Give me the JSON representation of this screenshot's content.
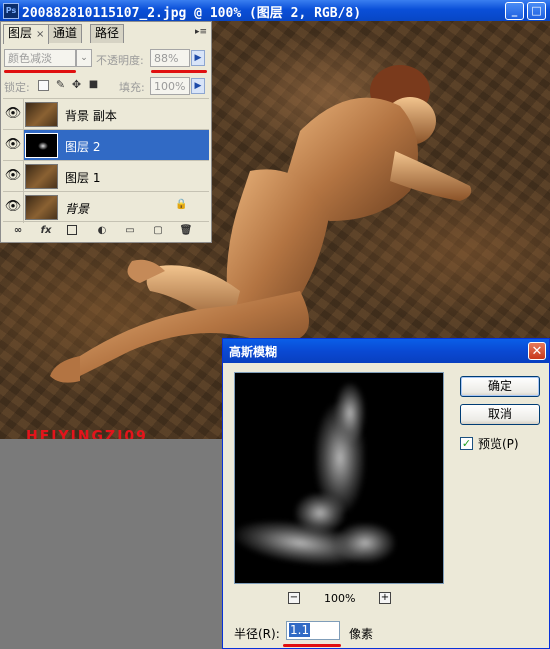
{
  "window": {
    "title": "200882810115107_2.jpg @ 100% (图层 2, RGB/8)",
    "app_icon": "Ps",
    "minimize": "_",
    "maximize": "□",
    "close": "✕"
  },
  "watermark": "HEIYINGZI09",
  "layers_panel": {
    "tabs": [
      {
        "label": "图层",
        "close": "×",
        "active": true
      },
      {
        "label": "通道",
        "active": false
      },
      {
        "label": "路径",
        "active": false
      }
    ],
    "blend_mode": "颜色减淡",
    "opacity_label": "不透明度:",
    "opacity_value": "88%",
    "lock_label": "锁定:",
    "fill_label": "填充:",
    "fill_value": "100%",
    "layers": [
      {
        "name": "背景 副本",
        "visible": true,
        "selected": false,
        "thumb": "photo",
        "locked": false,
        "italic": false
      },
      {
        "name": "图层 2",
        "visible": true,
        "selected": true,
        "thumb": "dark",
        "locked": false,
        "italic": false
      },
      {
        "name": "图层 1",
        "visible": true,
        "selected": false,
        "thumb": "photo",
        "locked": false,
        "italic": false
      },
      {
        "name": "背景",
        "visible": true,
        "selected": false,
        "thumb": "photo",
        "locked": true,
        "italic": true
      }
    ],
    "footer_icons": [
      "link-icon",
      "fx-icon",
      "mask-icon",
      "adjustment-icon",
      "folder-icon",
      "new-layer-icon",
      "trash-icon"
    ],
    "footer_fx": "fx"
  },
  "blur_dialog": {
    "title": "高斯模糊",
    "ok_label": "确定",
    "cancel_label": "取消",
    "preview_label": "预览(P)",
    "preview_checked": true,
    "zoom_out": "−",
    "zoom_in": "+",
    "zoom_level": "100%",
    "radius_label": "半径(R):",
    "radius_value": "1.1",
    "radius_unit": "像素"
  },
  "colors": {
    "selection": "#316ac5",
    "highlight_marker": "#e01010",
    "title_bar": "#0a4fd8"
  }
}
